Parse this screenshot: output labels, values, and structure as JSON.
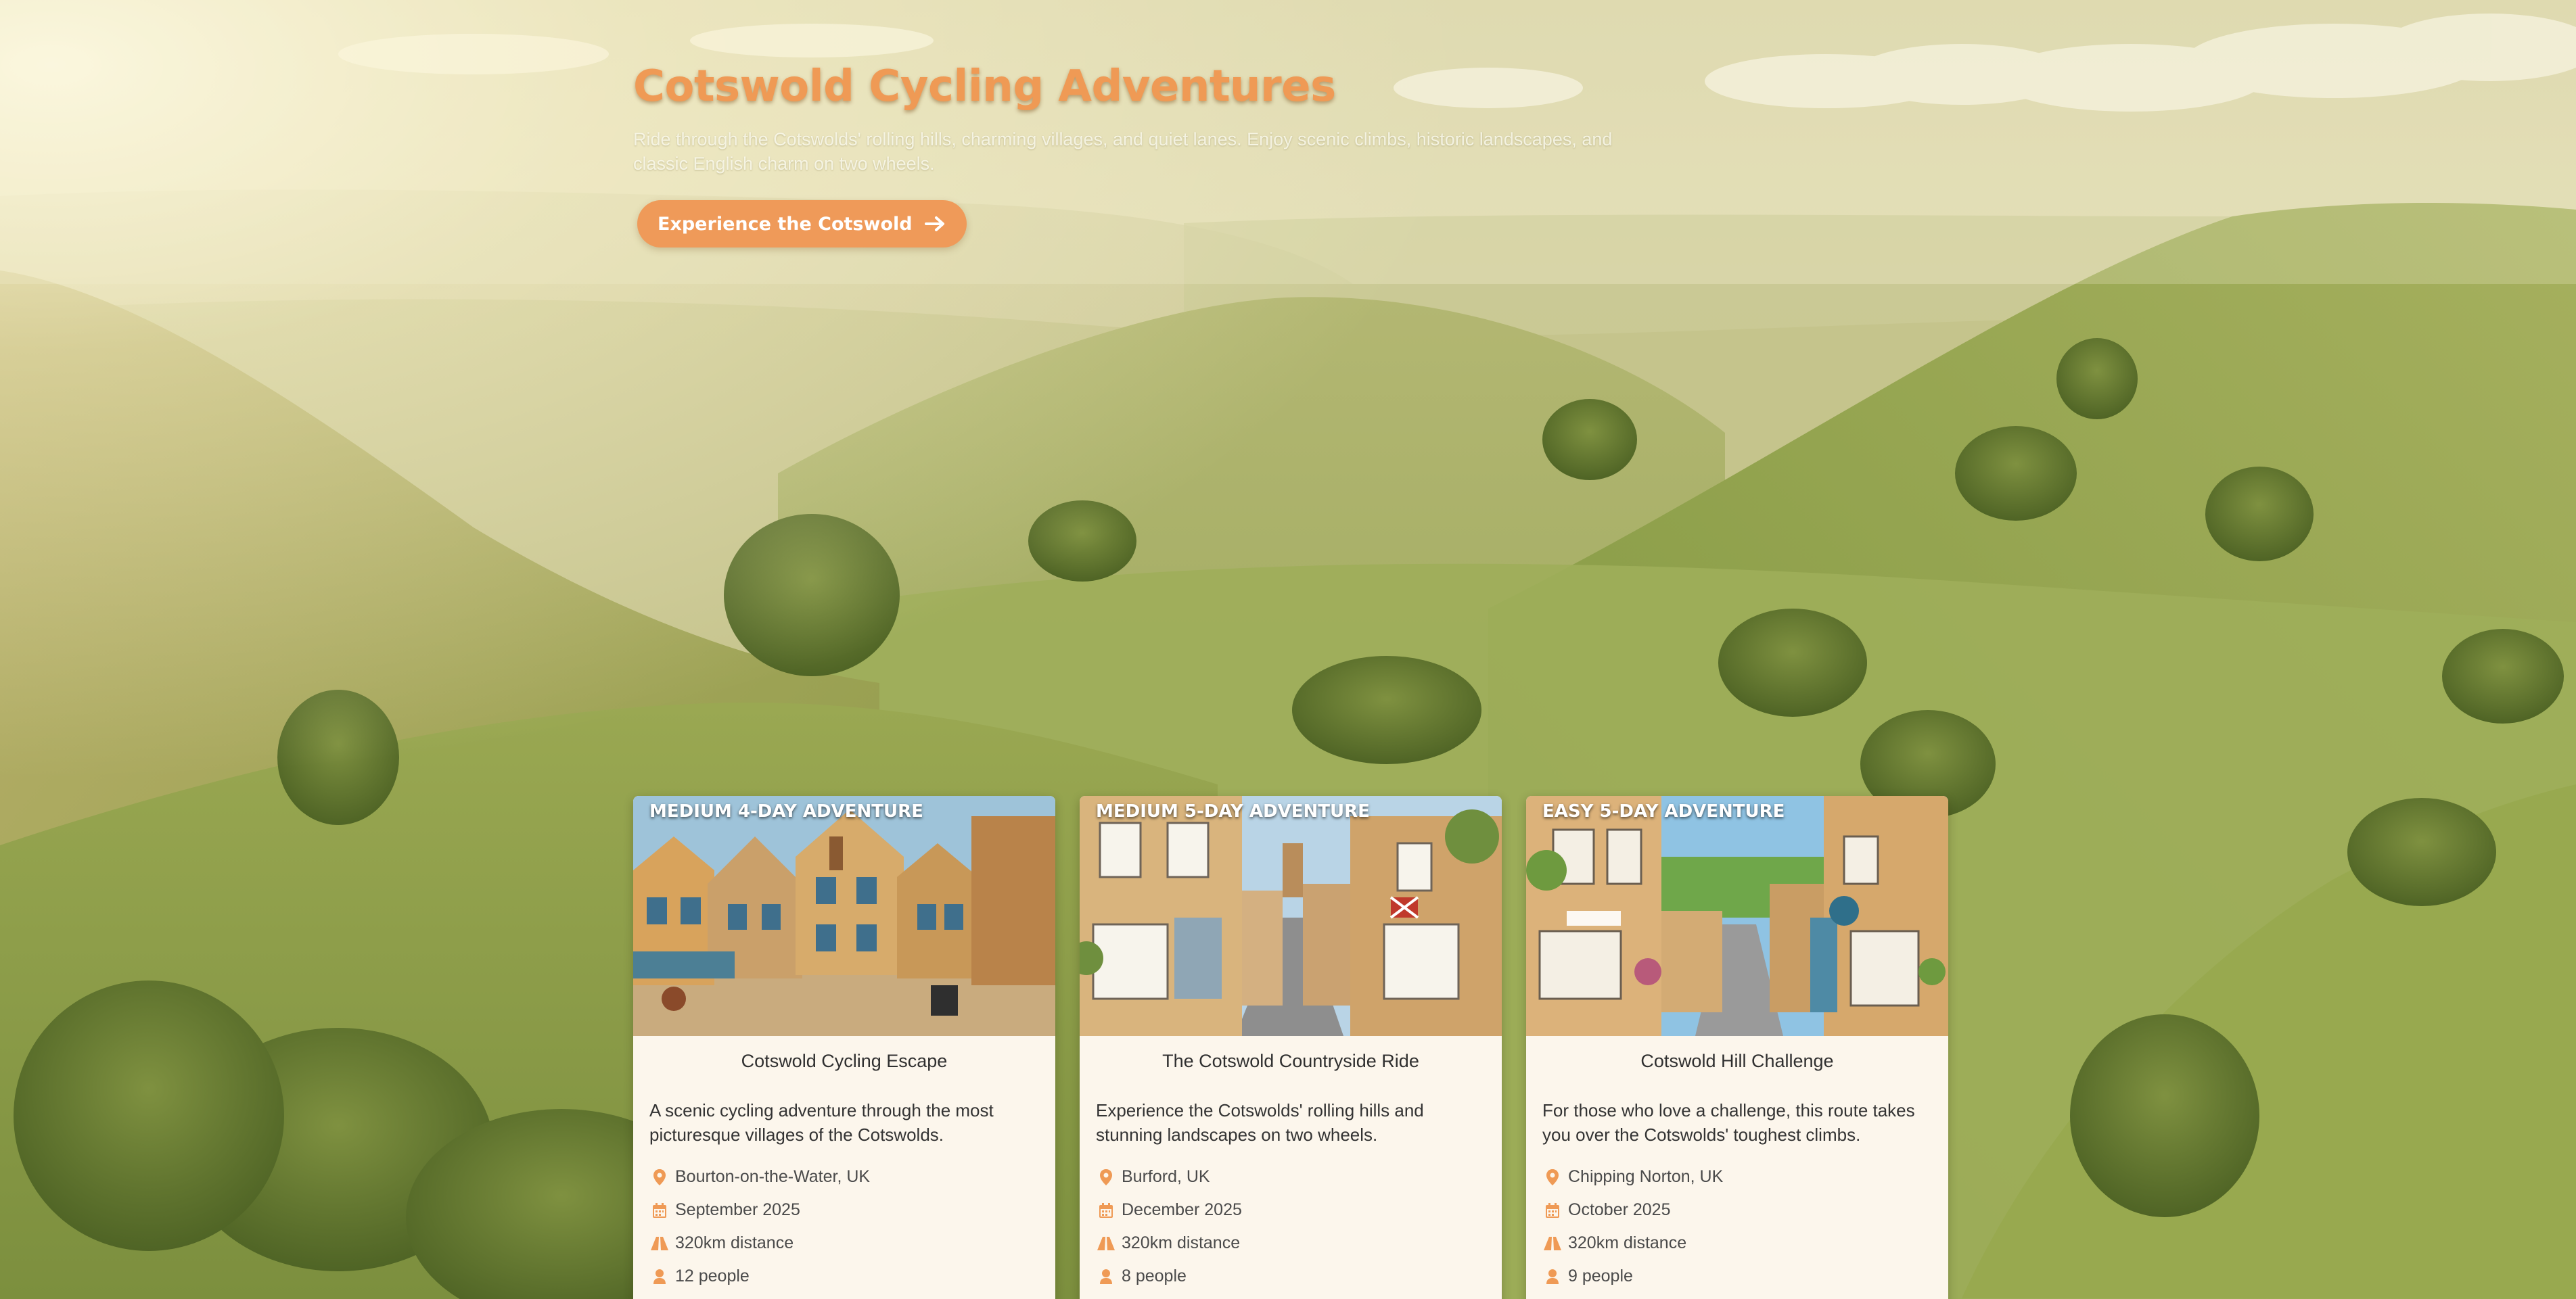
{
  "hero": {
    "title": "Cotswold Cycling Adventures",
    "subtitle": "Ride through the Cotswolds' rolling hills, charming villages, and quiet lanes. Enjoy scenic climbs, historic landscapes, and classic English charm on two wheels.",
    "cta_label": "Experience the Cotswold",
    "cta_icon": "arrow-right-icon"
  },
  "colors": {
    "accent": "#ef9a55",
    "card_bg": "#fcf6ec",
    "icon": "#ef9a55"
  },
  "cards": [
    {
      "badge": "MEDIUM 4-DAY ADVENTURE",
      "title": "Cotswold Cycling Escape",
      "description": "A scenic cycling adventure through the most picturesque villages of the Cotswolds.",
      "location": "Bourton-on-the-Water, UK",
      "date": "September 2025",
      "distance": "320km distance",
      "people": "12 people"
    },
    {
      "badge": "MEDIUM 5-DAY ADVENTURE",
      "title": "The Cotswold Countryside Ride",
      "description": "Experience the Cotswolds' rolling hills and stunning landscapes on two wheels.",
      "location": "Burford, UK",
      "date": "December 2025",
      "distance": "320km distance",
      "people": "8 people"
    },
    {
      "badge": "EASY 5-DAY ADVENTURE",
      "title": "Cotswold Hill Challenge",
      "description": "For those who love a challenge, this route takes you over the Cotswolds' toughest climbs.",
      "location": "Chipping Norton, UK",
      "date": "October 2025",
      "distance": "320km distance",
      "people": "9 people"
    }
  ],
  "icons": {
    "location": "map-pin-icon",
    "date": "calendar-icon",
    "distance": "road-icon",
    "people": "person-icon"
  }
}
